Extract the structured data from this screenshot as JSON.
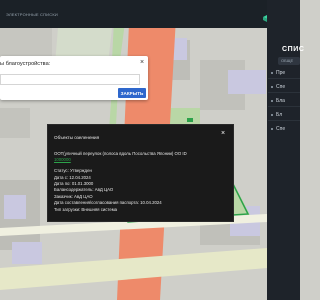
{
  "topbar": {
    "label": "ЭЛЕКТРОННЫЕ СПИСКИ"
  },
  "sidepanel": {
    "title": "СПИС",
    "badge": "ОБЩЕ",
    "items": [
      "Пре",
      "Спе",
      "Бла",
      "Бл",
      "Спе"
    ]
  },
  "dialog": {
    "title": "ы благоустройства:",
    "close_label": "×",
    "button_label": "ЗАКРЫТЬ"
  },
  "popup": {
    "header": "Объекты озеленения",
    "close_label": "×",
    "line1": "ООТ(уличный переулок (полоса вдоль Посольства Японии) ОО ID",
    "link_text": "1000000",
    "status": "Статус: Утвержден",
    "date_from": "Дата с: 12.04.2024",
    "date_to": "Дата по: 01.01.3000",
    "holder": "Балансодержатель: АвД ЦАО",
    "customer": "Заказчик: АвД ЦАО",
    "passport_date": "Дата составления/согласования паспорта: 10.04.2024",
    "load_type": "Тип загрузки: Внешняя система"
  },
  "colors": {
    "road": "#ee8a6a",
    "greenery": "#b9d7a6",
    "highlight": "#2ca24a",
    "button": "#2e67cc",
    "panel": "#1e232a"
  }
}
